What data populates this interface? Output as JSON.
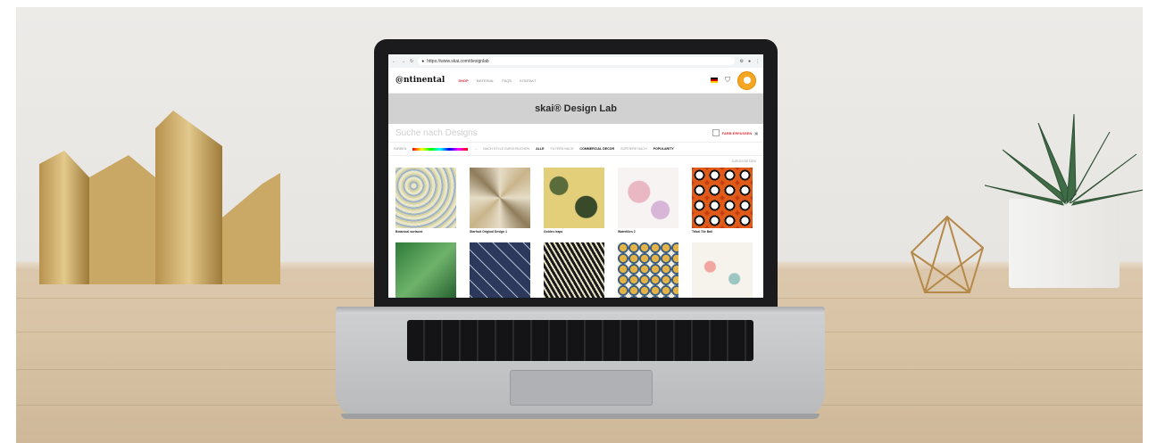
{
  "browser": {
    "url": "https://www.skai.com/designlab"
  },
  "header": {
    "logo": "@ntinental",
    "nav": [
      "SHOP",
      "MATERIAL",
      "FAQS",
      "KONTAKT"
    ]
  },
  "banner": {
    "title": "skai® Design Lab"
  },
  "search": {
    "placeholder": "Suche nach Designs",
    "tag_label": "FARB ERFASSEN"
  },
  "filters": [
    {
      "label": "FARBEN",
      "value": ""
    },
    {
      "label": "NACH STYLE DURCHSUCHEN",
      "value": "ALLE"
    },
    {
      "label": "FILTERN NACH",
      "value": "COMMERCIAL DECOR"
    },
    {
      "label": "SORTIERE NACH",
      "value": "POPULARITY"
    }
  ],
  "reset_label": "ZURÜCKSETZEN",
  "designs": [
    {
      "name": "Botanical surfaced"
    },
    {
      "name": "Starfruit Original Design 1"
    },
    {
      "name": "Golden leaps"
    },
    {
      "name": "Waterlilies 2"
    },
    {
      "name": "Tribal Tile Bali"
    },
    {
      "name": ""
    },
    {
      "name": ""
    },
    {
      "name": ""
    },
    {
      "name": ""
    },
    {
      "name": ""
    }
  ],
  "icons": {
    "back": "back-arrow-icon",
    "forward": "forward-arrow-icon",
    "reload": "reload-icon",
    "lock": "lock-icon",
    "cart": "cart-icon",
    "account": "avatar-icon"
  }
}
